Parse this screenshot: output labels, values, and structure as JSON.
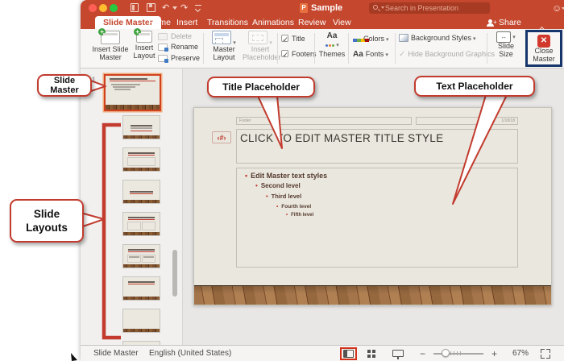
{
  "titlebar": {
    "title": "Sample",
    "search_placeholder": "Search in Presentation",
    "share_label": "Share"
  },
  "tabs": {
    "active": "Slide Master",
    "items": [
      "Slide Master",
      "Home",
      "Insert",
      "Transitions",
      "Animations",
      "Review",
      "View"
    ]
  },
  "ribbon": {
    "insert_slide_master": "Insert Slide Master",
    "insert_layout": "Insert Layout",
    "delete": "Delete",
    "rename": "Rename",
    "preserve": "Preserve",
    "master_layout": "Master Layout",
    "insert_placeholder": "Insert Placeholder",
    "title_checkbox": "Title",
    "footers_checkbox": "Footers",
    "themes": "Themes",
    "themes_icon_glyph": "Aa",
    "colors": "Colors",
    "fonts": "Fonts",
    "fonts_icon_glyph": "Aa",
    "background_styles": "Background Styles",
    "hide_background_graphics": "Hide Background Graphics",
    "slide_size": "Slide Size",
    "slide_size_icon_glyph": "↔",
    "close_master": "Close Master"
  },
  "thumbnails": {
    "master_number": "1"
  },
  "slide": {
    "footer_placeholder": "Footer",
    "date_placeholder": "1/18/18",
    "slide_number_symbol": "‹#›",
    "title": "CLICK TO EDIT MASTER TITLE STYLE",
    "bullet_char": "•",
    "bullets": [
      "Edit Master text styles",
      "Second level",
      "Third level",
      "Fourth level",
      "Fifth level"
    ]
  },
  "callouts": {
    "slide_master": "Slide Master",
    "title_placeholder": "Title Placeholder",
    "text_placeholder": "Text Placeholder",
    "slide_layouts": "Slide Layouts"
  },
  "status_bar": {
    "view": "Slide Master",
    "language": "English (United States)",
    "zoom_level": "67%"
  },
  "colors": {
    "ribbon_red": "#C5472E",
    "callout_red": "#C23B2E",
    "close_master_highlight": "#17356B",
    "selection_red": "#D2401E",
    "bullet_accent": "#C0392B"
  }
}
